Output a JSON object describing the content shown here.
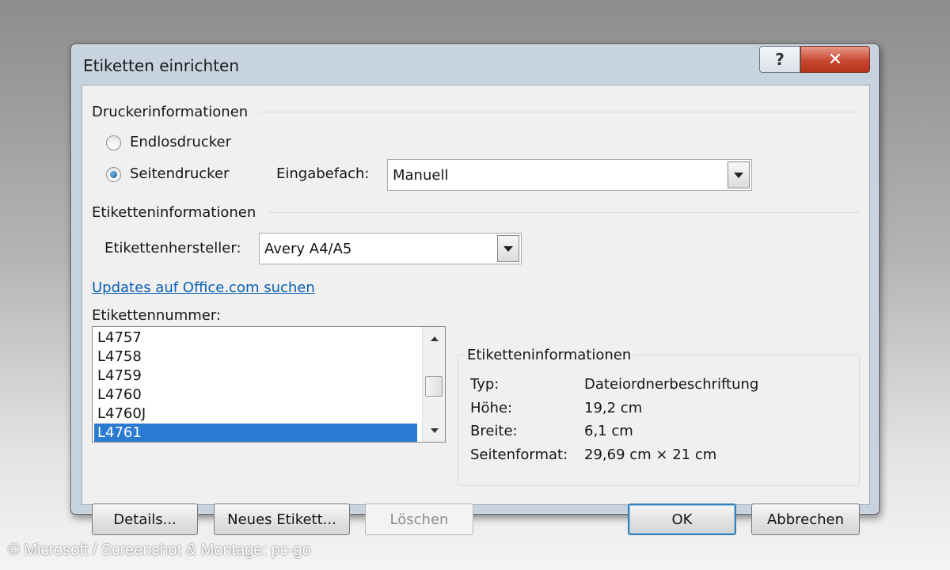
{
  "window": {
    "title": "Etiketten einrichten",
    "help_label": "?",
    "close_label": "✕"
  },
  "printer_info": {
    "heading": "Druckerinformationen",
    "endless_label": "Endlosdrucker",
    "page_label": "Seitendrucker",
    "selected": "Seitendrucker",
    "tray_label": "Eingabefach:",
    "tray_value": "Manuell"
  },
  "label_info": {
    "heading": "Etiketteninformationen",
    "vendor_label": "Etikettenhersteller:",
    "vendor_value": "Avery A4/A5"
  },
  "updates_link": "Updates auf Office.com suchen",
  "label_number": {
    "heading": "Etikettennummer:",
    "items": [
      "L4757",
      "L4758",
      "L4759",
      "L4760",
      "L4760J",
      "L4761"
    ],
    "selected": "L4761"
  },
  "details_panel": {
    "title": "Etiketteninformationen",
    "rows": [
      {
        "key": "Typ:",
        "value": "Dateiordnerbeschriftung"
      },
      {
        "key": "Höhe:",
        "value": "19,2 cm"
      },
      {
        "key": "Breite:",
        "value": "6,1 cm"
      },
      {
        "key": "Seitenformat:",
        "value": "29,69 cm × 21 cm"
      }
    ]
  },
  "buttons": {
    "details": "Details...",
    "new_label": "Neues Etikett...",
    "delete": "Löschen",
    "ok": "OK",
    "cancel": "Abbrechen"
  },
  "copyright": "© Microsoft / Screenshot & Montage: pc-go",
  "colors": {
    "selection": "#2b7bd2",
    "link": "#0a5fb4",
    "close_button": "#c9472f"
  }
}
